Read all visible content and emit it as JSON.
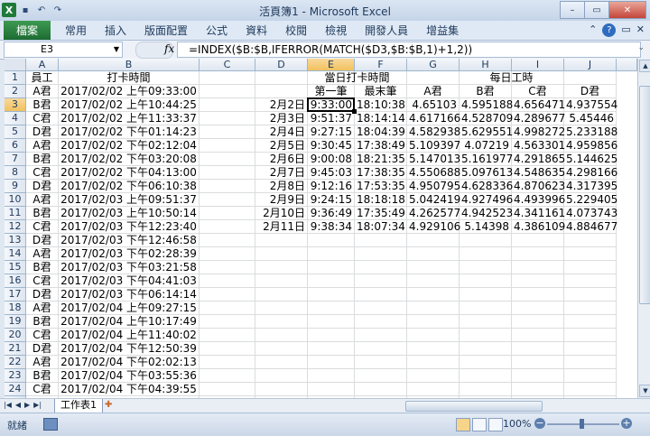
{
  "window": {
    "title": "活頁簿1 - Microsoft Excel"
  },
  "qat": {
    "app_icon": "X",
    "save_icon": "floppy-icon",
    "undo": "↶",
    "redo": "↷"
  },
  "window_controls": {
    "minimize": "–",
    "maximize": "▭",
    "close": "✕"
  },
  "ribbon": {
    "file_tab": "檔案",
    "tabs": [
      "常用",
      "插入",
      "版面配置",
      "公式",
      "資料",
      "校閱",
      "檢視",
      "開發人員",
      "增益集"
    ],
    "help": "?"
  },
  "formula_bar": {
    "name_box": "E3",
    "fx": "fx",
    "formula": "=INDEX($B:$B,IFERROR(MATCH($D3,$B:$B,1)+1,2))"
  },
  "columns": [
    "A",
    "B",
    "C",
    "D",
    "E",
    "F",
    "G",
    "H",
    "I",
    "J"
  ],
  "rows": [
    "1",
    "2",
    "3",
    "4",
    "5",
    "6",
    "7",
    "8",
    "9",
    "10",
    "11",
    "12",
    "13",
    "14",
    "15",
    "16",
    "17",
    "18",
    "19",
    "20",
    "21",
    "22",
    "23",
    "24",
    "25"
  ],
  "cells": {
    "A": [
      "員工",
      "A君",
      "B君",
      "C君",
      "D君",
      "A君",
      "B君",
      "C君",
      "D君",
      "A君",
      "B君",
      "C君",
      "D君",
      "A君",
      "B君",
      "C君",
      "D君",
      "A君",
      "B君",
      "C君",
      "D君",
      "A君",
      "B君",
      "C君"
    ],
    "B": [
      "打卡時間",
      "2017/02/02 上午09:33:00",
      "2017/02/02 上午10:44:25",
      "2017/02/02 上午11:33:37",
      "2017/02/02 下午01:14:23",
      "2017/02/02 下午02:12:04",
      "2017/02/02 下午03:20:08",
      "2017/02/02 下午04:13:00",
      "2017/02/02 下午06:10:38",
      "2017/02/03 上午09:51:37",
      "2017/02/03 上午10:50:14",
      "2017/02/03 下午12:23:40",
      "2017/02/03 下午12:46:58",
      "2017/02/03 下午02:28:39",
      "2017/02/03 下午03:21:58",
      "2017/02/03 下午04:41:03",
      "2017/02/03 下午06:14:14",
      "2017/02/04 上午09:27:15",
      "2017/02/04 上午10:17:49",
      "2017/02/04 上午11:40:02",
      "2017/02/04 下午12:50:39",
      "2017/02/04 下午02:02:13",
      "2017/02/04 下午03:55:36",
      "2017/02/04 下午04:39:55"
    ],
    "E_F_header": "當日打卡時間",
    "G_J_header": "每日工時",
    "row2": {
      "E": "第一筆",
      "F": "最末筆",
      "G": "A君",
      "H": "B君",
      "I": "C君",
      "J": "D君"
    },
    "table": [
      {
        "D": "2月2日",
        "E": "9:33:00",
        "F": "18:10:38",
        "G": "4.65103",
        "H": "4.595188",
        "I": "4.656471",
        "J": "4.937554"
      },
      {
        "D": "2月3日",
        "E": "9:51:37",
        "F": "18:14:14",
        "G": "4.617166",
        "H": "4.528709",
        "I": "4.289677",
        "J": "5.45446"
      },
      {
        "D": "2月4日",
        "E": "9:27:15",
        "F": "18:04:39",
        "G": "4.582938",
        "H": "5.629551",
        "I": "4.998272",
        "J": "5.233188"
      },
      {
        "D": "2月5日",
        "E": "9:30:45",
        "F": "17:38:49",
        "G": "5.109397",
        "H": "4.07219",
        "I": "4.563301",
        "J": "4.959856"
      },
      {
        "D": "2月6日",
        "E": "9:00:08",
        "F": "18:21:35",
        "G": "5.147013",
        "H": "5.161977",
        "I": "4.291865",
        "J": "5.144625"
      },
      {
        "D": "2月7日",
        "E": "9:45:03",
        "F": "17:38:35",
        "G": "4.550688",
        "H": "5.097613",
        "I": "4.548635",
        "J": "4.298166"
      },
      {
        "D": "2月8日",
        "E": "9:12:16",
        "F": "17:53:35",
        "G": "4.950795",
        "H": "4.628336",
        "I": "4.870623",
        "J": "4.317395"
      },
      {
        "D": "2月9日",
        "E": "9:24:15",
        "F": "18:18:18",
        "G": "5.042419",
        "H": "4.927496",
        "I": "4.493996",
        "J": "5.229405"
      },
      {
        "D": "2月10日",
        "E": "9:36:49",
        "F": "17:35:49",
        "G": "4.262577",
        "H": "4.942523",
        "I": "4.341161",
        "J": "4.073743"
      },
      {
        "D": "2月11日",
        "E": "9:38:34",
        "F": "18:07:34",
        "G": "4.929106",
        "H": "5.14398",
        "I": "4.386109",
        "J": "4.884677"
      }
    ]
  },
  "sheet_tab": "工作表1",
  "status": {
    "mode": "就緒",
    "zoom": "100%"
  }
}
